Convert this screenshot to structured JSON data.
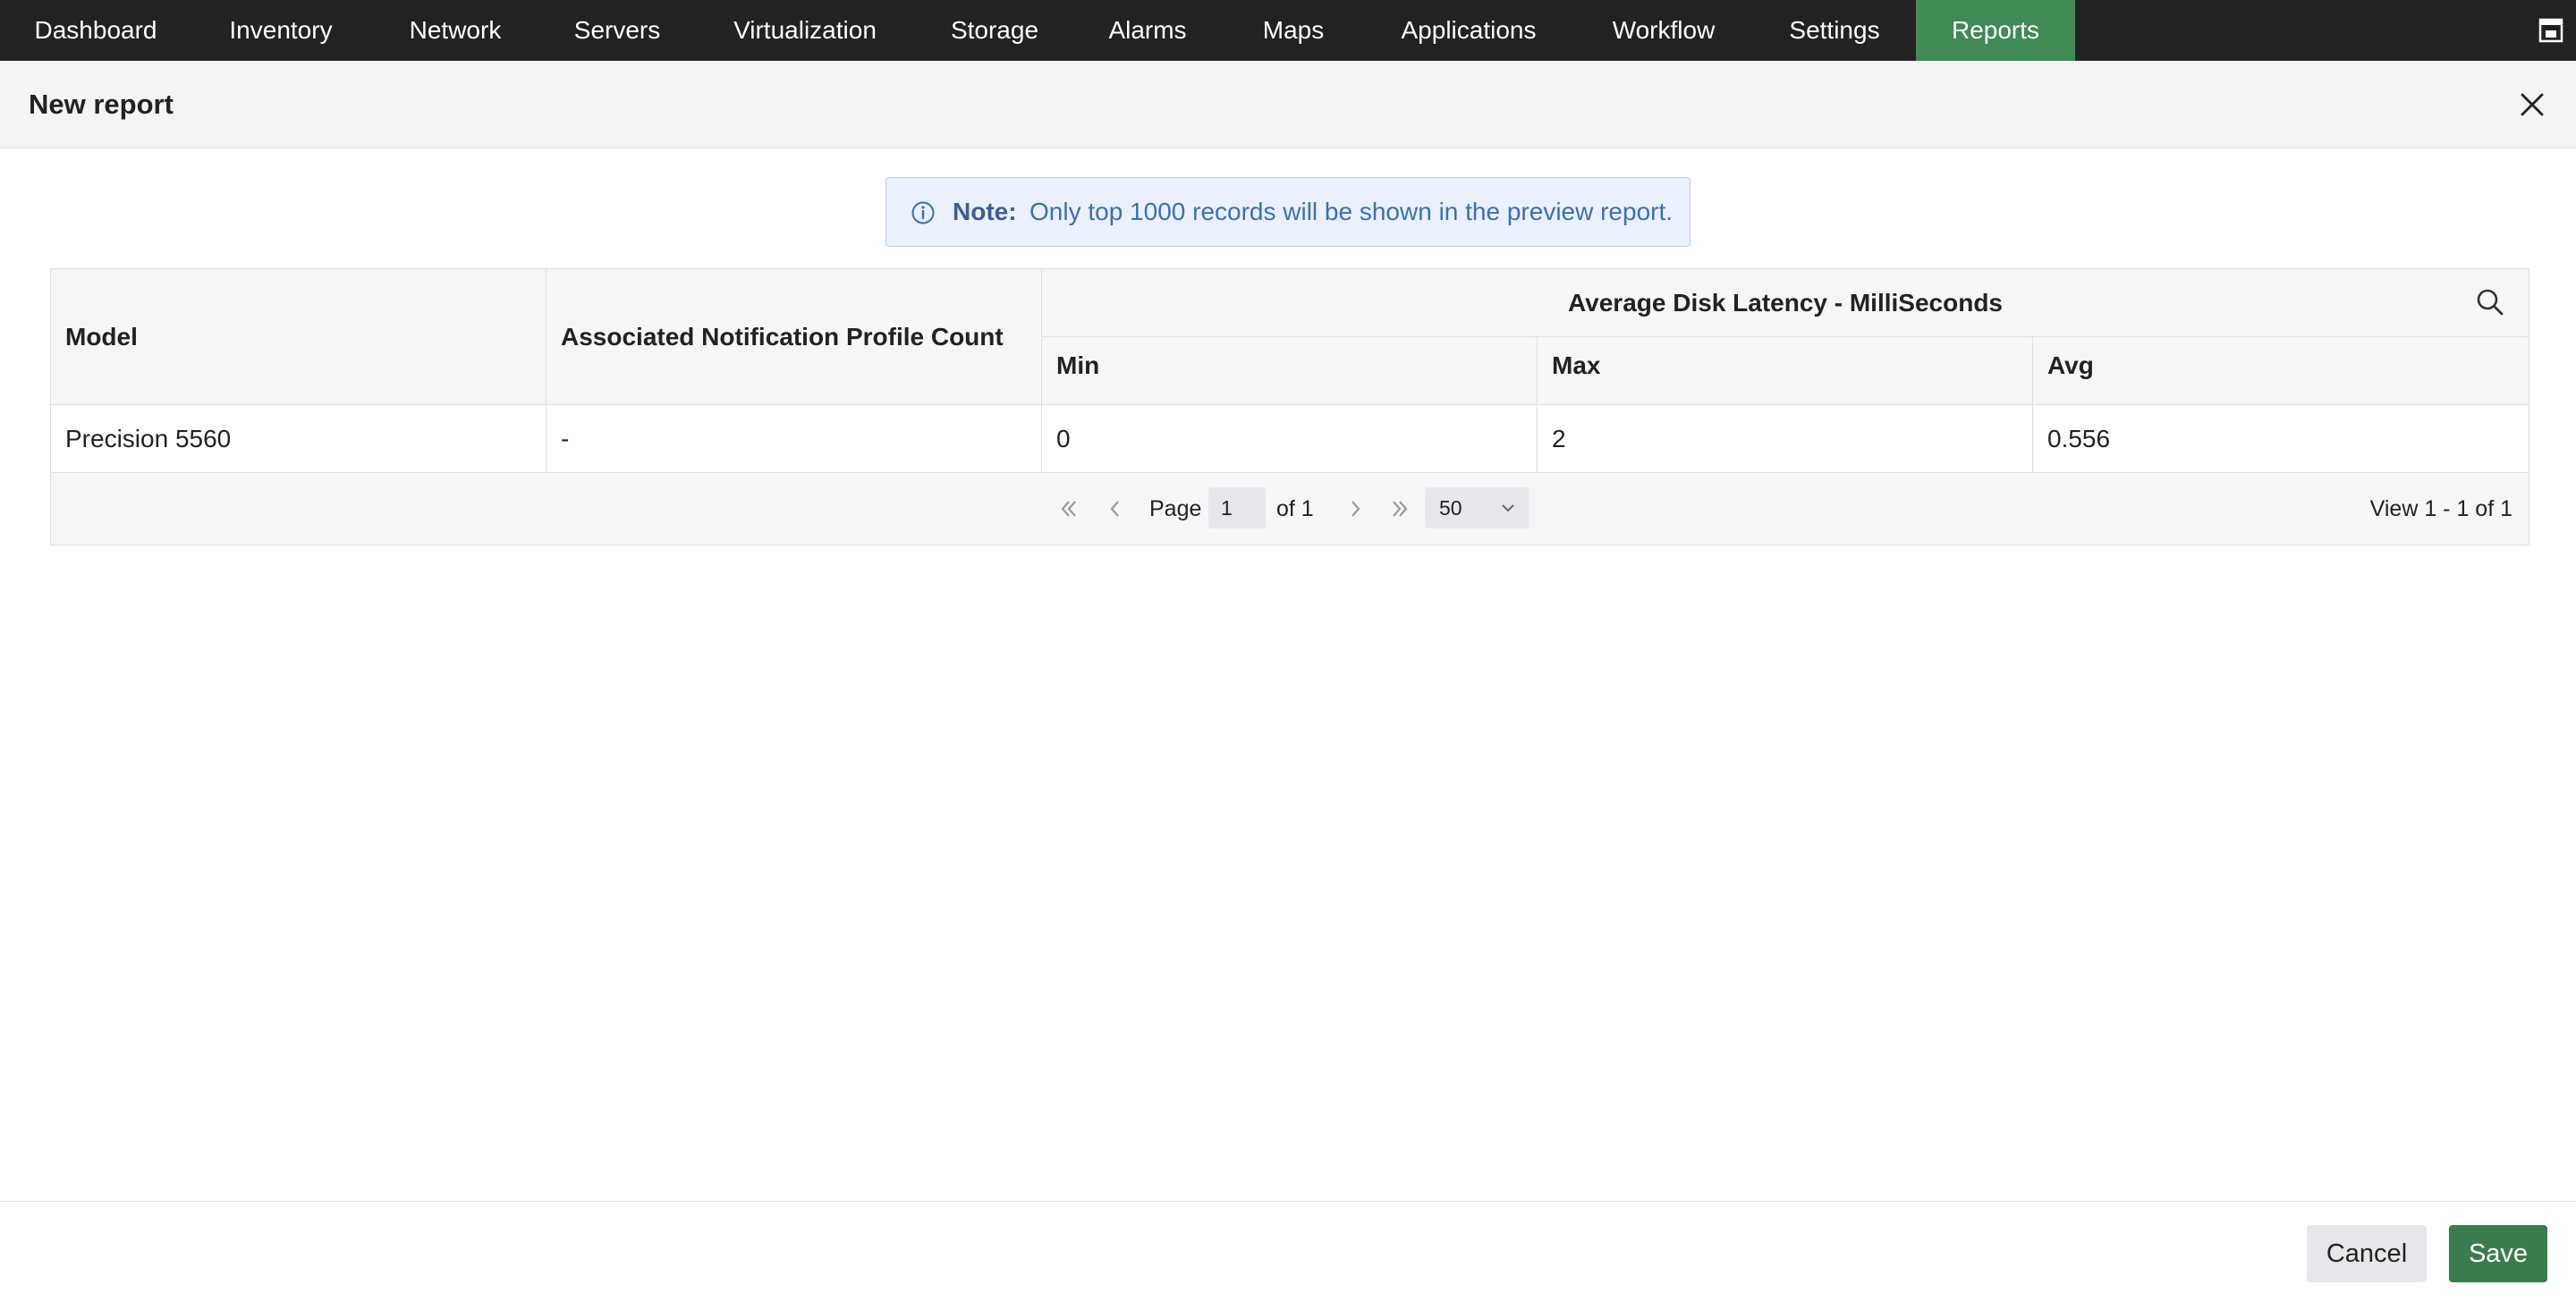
{
  "nav": {
    "items": [
      {
        "label": "Dashboard"
      },
      {
        "label": "Inventory"
      },
      {
        "label": "Network"
      },
      {
        "label": "Servers"
      },
      {
        "label": "Virtualization"
      },
      {
        "label": "Storage"
      },
      {
        "label": "Alarms"
      },
      {
        "label": "Maps"
      },
      {
        "label": "Applications"
      },
      {
        "label": "Workflow"
      },
      {
        "label": "Settings"
      },
      {
        "label": "Reports"
      }
    ],
    "active": "Reports",
    "accent_color": "#3f8a55"
  },
  "header": {
    "title": "New report"
  },
  "note": {
    "label": "Note:",
    "text": "Only top 1000 records will be shown in the preview report."
  },
  "table": {
    "columns": {
      "model": "Model",
      "notification_count": "Associated Notification Profile Count",
      "group": "Average Disk Latency - MilliSeconds",
      "min": "Min",
      "max": "Max",
      "avg": "Avg"
    },
    "rows": [
      {
        "model": "Precision 5560",
        "notification_count": "-",
        "min": "0",
        "max": "2",
        "avg": "0.556"
      }
    ]
  },
  "pager": {
    "page_label": "Page",
    "page_value": "1",
    "of_label": "of 1",
    "page_size": "50",
    "view_text": "View 1 - 1 of 1"
  },
  "footer": {
    "cancel_label": "Cancel",
    "save_label": "Save",
    "save_color": "#3a7d4d"
  }
}
